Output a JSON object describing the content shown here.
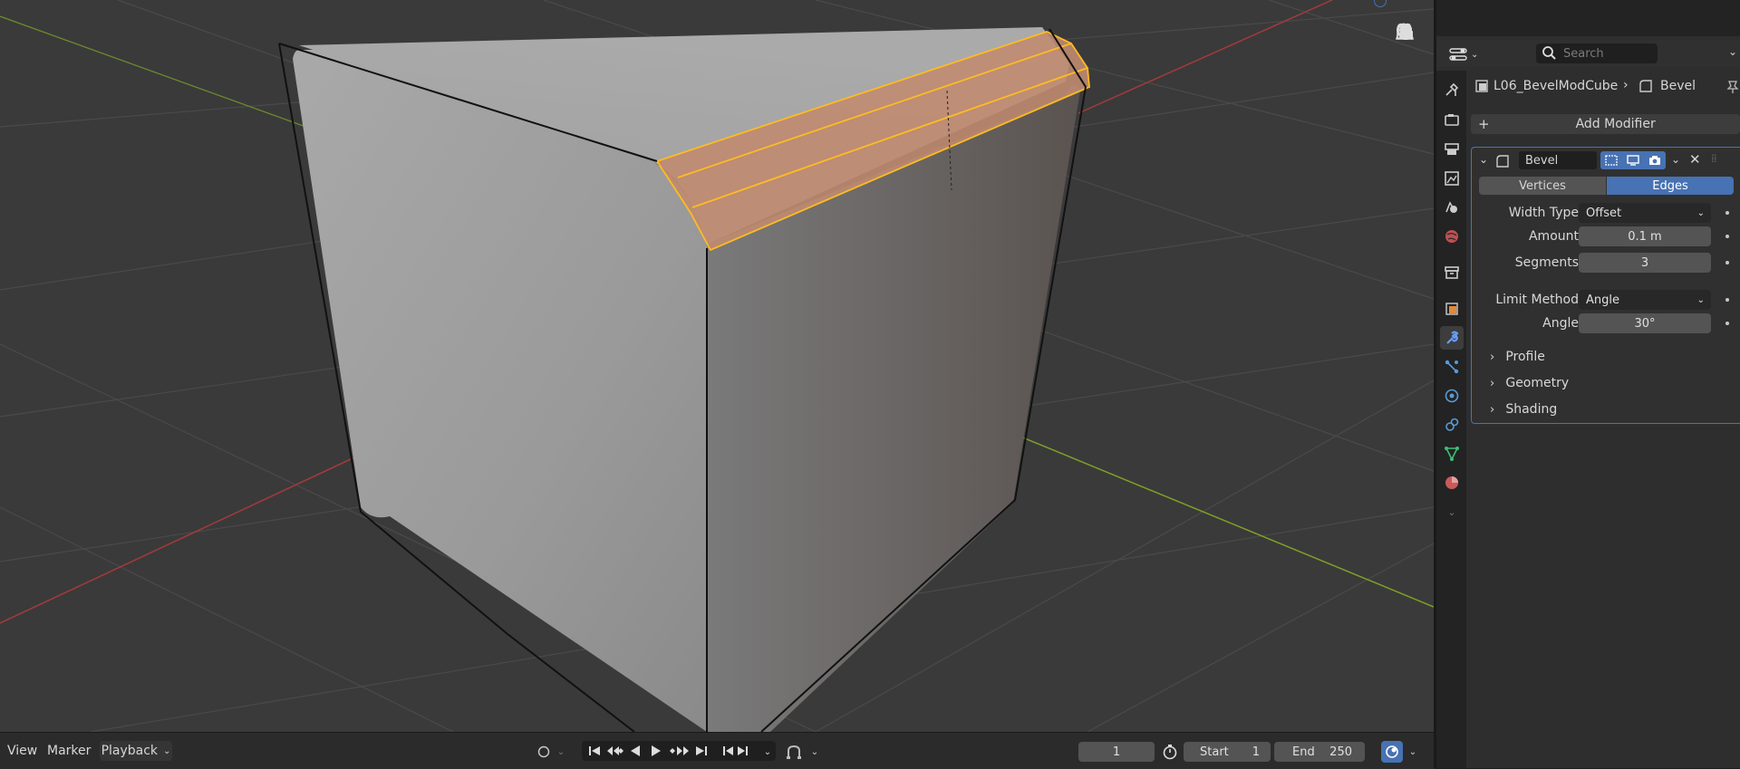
{
  "timeline": {
    "view": "View",
    "marker": "Marker",
    "playback": "Playback",
    "current_frame": "1",
    "start_label": "Start",
    "start_value": "1",
    "end_label": "End",
    "end_value": "250"
  },
  "properties": {
    "search_placeholder": "Search",
    "breadcrumb_object": "L06_BevelModCube",
    "breadcrumb_modifier": "Bevel",
    "add_modifier": "Add Modifier",
    "modifier": {
      "name": "Bevel",
      "affect_vertices": "Vertices",
      "affect_edges": "Edges",
      "width_type_label": "Width Type",
      "width_type_value": "Offset",
      "amount_label": "Amount",
      "amount_value": "0.1 m",
      "segments_label": "Segments",
      "segments_value": "3",
      "limit_method_label": "Limit Method",
      "limit_method_value": "Angle",
      "angle_label": "Angle",
      "angle_value": "30°",
      "subpanels": [
        "Profile",
        "Geometry",
        "Shading"
      ]
    }
  },
  "colors": {
    "accent": "#4772b3",
    "selection": "#ffbb22",
    "viewport_bg": "#3a3a3a"
  }
}
